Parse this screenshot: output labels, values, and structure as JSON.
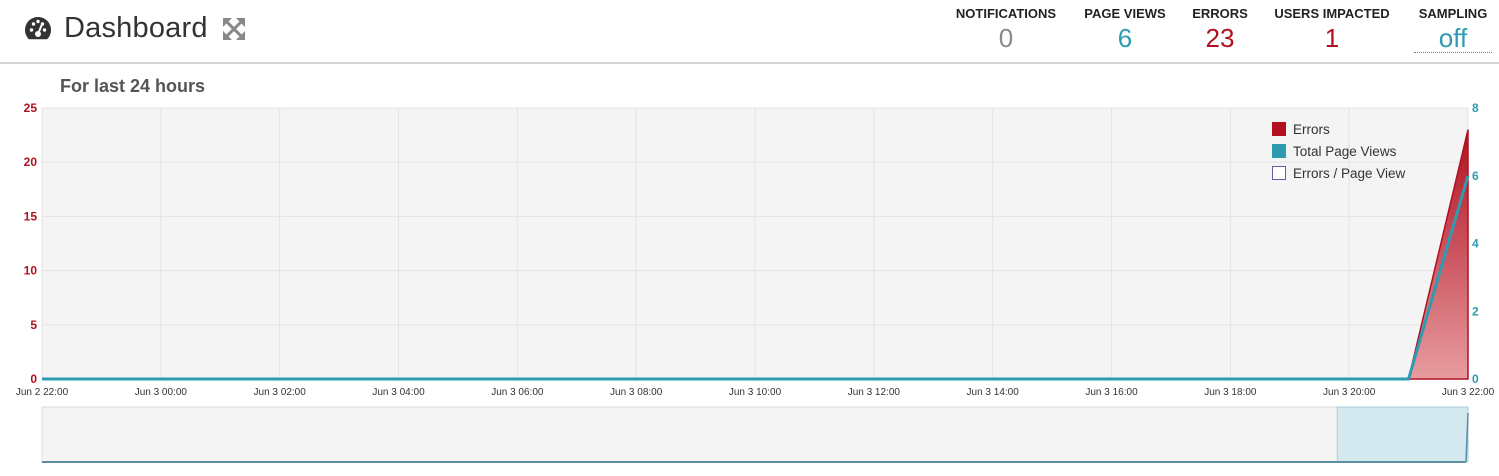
{
  "header": {
    "title": "Dashboard",
    "title_icon": "dashboard-gauge-icon",
    "expand_icon": "expand-arrows-icon"
  },
  "stats": [
    {
      "key": "notifications",
      "label": "NOTIFICATIONS",
      "value": "0",
      "color": "#8a8a8a"
    },
    {
      "key": "page-views",
      "label": "PAGE VIEWS",
      "value": "6",
      "color": "#2e9bb0"
    },
    {
      "key": "errors",
      "label": "ERRORS",
      "value": "23",
      "color": "#b01020"
    },
    {
      "key": "users-impacted",
      "label": "USERS IMPACTED",
      "value": "1",
      "color": "#b01020"
    },
    {
      "key": "sampling",
      "label": "SAMPLING",
      "value": "off",
      "color": "#2e9bb0"
    }
  ],
  "subtitle": "For last 24 hours",
  "colors": {
    "errors": "#b01020",
    "page_views": "#2e9bb0",
    "ratio": "#6a5aa0",
    "plot_bg": "#f4f4f4",
    "nav_selection": "#d4e8f0"
  },
  "legend": [
    {
      "label": "Errors",
      "type": "filled",
      "color": "#b01020"
    },
    {
      "label": "Total Page Views",
      "type": "filled",
      "color": "#2e9bb0"
    },
    {
      "label": "Errors / Page View",
      "type": "outline",
      "color": "#6a5aa0"
    }
  ],
  "chart_data": {
    "type": "area",
    "x_ticks": [
      "Jun 2 22:00",
      "Jun 3 00:00",
      "Jun 3 02:00",
      "Jun 3 04:00",
      "Jun 3 06:00",
      "Jun 3 08:00",
      "Jun 3 10:00",
      "Jun 3 12:00",
      "Jun 3 14:00",
      "Jun 3 16:00",
      "Jun 3 18:00",
      "Jun 3 20:00",
      "Jun 3 22:00"
    ],
    "xlim": [
      "Jun 2 22:00",
      "Jun 3 22:00"
    ],
    "y_left": {
      "ticks": [
        0,
        5,
        10,
        15,
        20,
        25
      ],
      "range": [
        0,
        25
      ]
    },
    "y_right": {
      "ticks": [
        0,
        2,
        4,
        6,
        8
      ],
      "range": [
        0,
        8
      ]
    },
    "grid": true,
    "legend_position": "top-right",
    "series": [
      {
        "name": "Errors",
        "axis": "left",
        "points": [
          [
            "Jun 2 22:00",
            0
          ],
          [
            "Jun 3 21:00",
            0
          ],
          [
            "Jun 3 22:00",
            23
          ]
        ]
      },
      {
        "name": "Total Page Views",
        "axis": "right",
        "points": [
          [
            "Jun 2 22:00",
            0
          ],
          [
            "Jun 3 21:00",
            0
          ],
          [
            "Jun 3 22:00",
            6
          ]
        ]
      },
      {
        "name": "Errors / Page View",
        "axis": "right",
        "points": []
      }
    ],
    "navigator": {
      "selection": [
        "Jun 3 19:48",
        "Jun 3 22:00"
      ]
    }
  }
}
